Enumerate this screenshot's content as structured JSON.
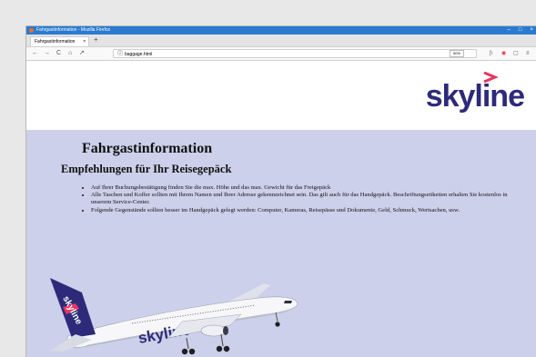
{
  "window": {
    "title": "Fahrgastinformation - Mozilla Firefox",
    "controls": [
      "–",
      "□",
      "×"
    ]
  },
  "tab": {
    "label": "Fahrgastinformation",
    "close": "×",
    "new_tab": "+"
  },
  "nav": {
    "back": "←",
    "forward": "→",
    "reload": "C",
    "home": "⌂",
    "pin": "↗",
    "url": "baggage.html",
    "zoom": "90%",
    "library": "|\\",
    "shield": "◉",
    "sidebar": "▢",
    "menu": "≡"
  },
  "site": {
    "logo": "skyline"
  },
  "page": {
    "heading": "Fahrgastinformation",
    "subheading": "Empfehlungen für Ihr Reisegepäck",
    "bullets": [
      "Auf Ihrer Buchungsbestätigung finden Sie die max. Höhe und das max. Gewicht für das Freigepäck",
      "Alle Taschen und Koffer sollten mit Ihrem Namen und Ihrer Adresse gekennzeichnet sein. Das gilt auch für das Handgepäck. Beschriftungsetiketten erhalten Sie kostenlos in unserem Service-Center.",
      "Folgende Gegenstände sollten besser im Handgepäck gelegt werden: Computer, Kameras, Reisepässe und Dokumente, Geld, Schmuck, Wertsachen, usw."
    ]
  },
  "plane": {
    "fuselage_text": "skyline",
    "tail_text": "skyline"
  },
  "colors": {
    "brand": "#2d2a7a",
    "content_bg": "#ccd0ea",
    "titlebar": "#2a7bd0"
  }
}
